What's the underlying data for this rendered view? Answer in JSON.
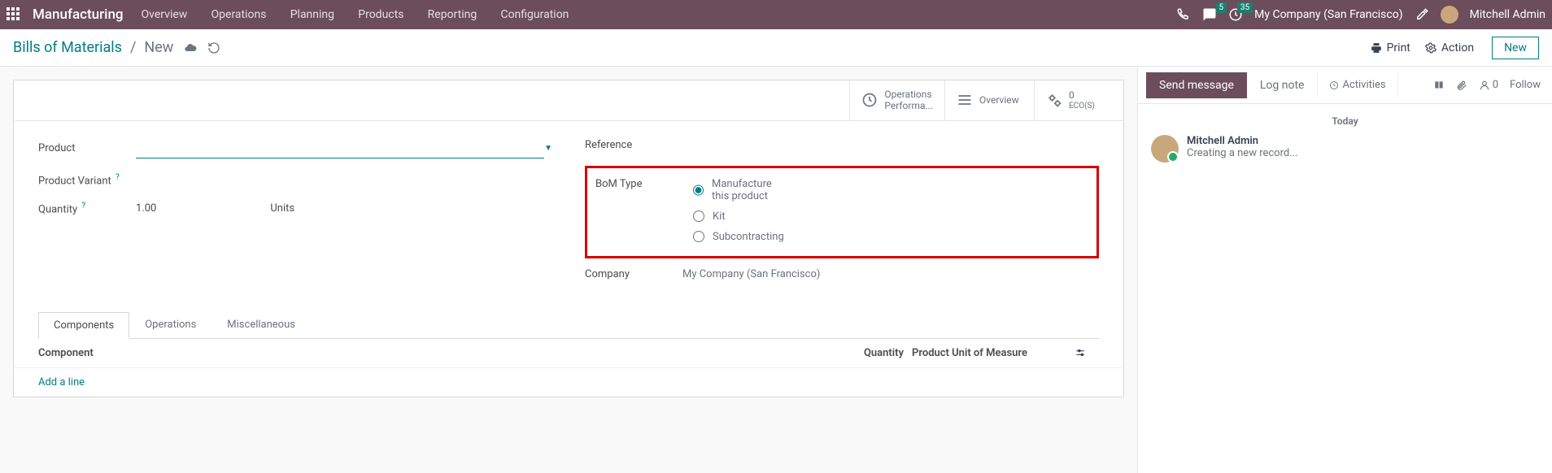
{
  "topbar": {
    "app_name": "Manufacturing",
    "nav": [
      "Overview",
      "Operations",
      "Planning",
      "Products",
      "Reporting",
      "Configuration"
    ],
    "messages_badge": "5",
    "activities_badge": "35",
    "company": "My Company (San Francisco)",
    "username": "Mitchell Admin"
  },
  "toolbar": {
    "crumb_root": "Bills of Materials",
    "crumb_current": "New",
    "print": "Print",
    "action": "Action",
    "new": "New"
  },
  "stats": {
    "operations_l1": "Operations",
    "operations_l2": "Performa...",
    "overview": "Overview",
    "ecos_count": "0",
    "ecos_label": "ECO(S)"
  },
  "form": {
    "labels": {
      "product": "Product",
      "variant": "Product Variant",
      "quantity": "Quantity",
      "reference": "Reference",
      "bom_type": "BoM Type",
      "company": "Company"
    },
    "quantity_value": "1.00",
    "quantity_unit": "Units",
    "bom_type_options": {
      "manufacture": "Manufacture this product",
      "kit": "Kit",
      "subcontracting": "Subcontracting"
    },
    "company_value": "My Company (San Francisco)"
  },
  "tabs": {
    "components": "Components",
    "operations": "Operations",
    "misc": "Miscellaneous"
  },
  "table": {
    "component": "Component",
    "quantity": "Quantity",
    "uom": "Product Unit of Measure",
    "add_line": "Add a line"
  },
  "chatter": {
    "send": "Send message",
    "log": "Log note",
    "activities": "Activities",
    "followers": "0",
    "follow": "Follow",
    "date": "Today",
    "author": "Mitchell Admin",
    "message": "Creating a new record..."
  }
}
